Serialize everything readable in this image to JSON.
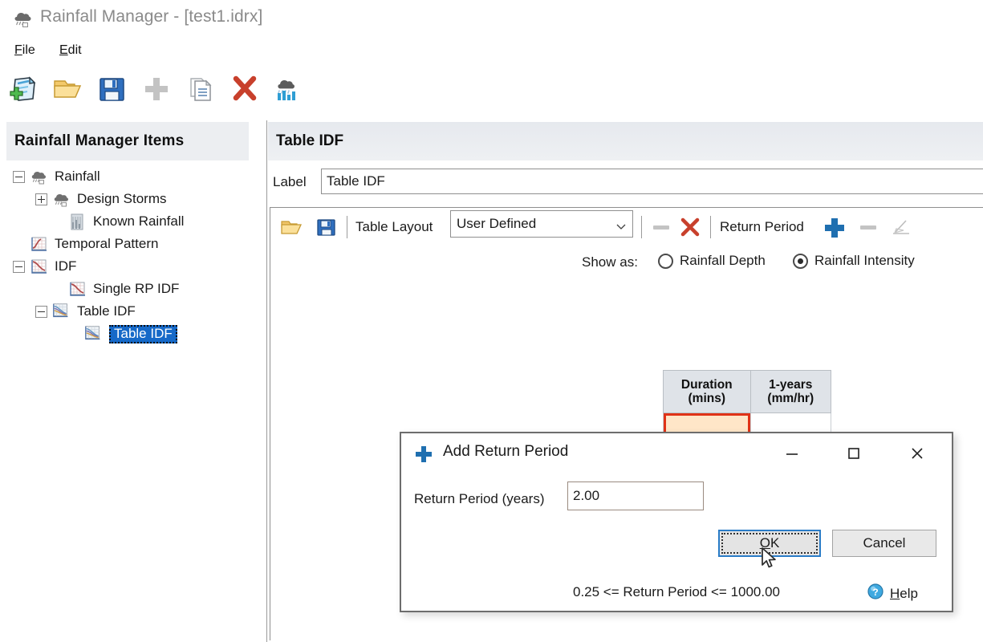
{
  "window": {
    "title": "Rainfall Manager - [test1.idrx]",
    "icon": "rain-cloud-icon"
  },
  "menubar": {
    "items": [
      {
        "label": "File",
        "mnemonic": "F",
        "rest": "ile"
      },
      {
        "label": "Edit",
        "mnemonic": "E",
        "rest": "dit"
      }
    ]
  },
  "toolbar": {
    "buttons": [
      {
        "name": "new-icon",
        "title": "New",
        "enabled": true
      },
      {
        "name": "open-folder-icon",
        "title": "Open",
        "enabled": true
      },
      {
        "name": "save-icon",
        "title": "Save",
        "enabled": true
      },
      {
        "name": "add-plus-icon",
        "title": "Add",
        "enabled": false
      },
      {
        "name": "copy-icon",
        "title": "Copy",
        "enabled": true
      },
      {
        "name": "delete-x-icon",
        "title": "Delete",
        "enabled": true
      },
      {
        "name": "rainfall-chart-icon",
        "title": "Rainfall",
        "enabled": true
      }
    ]
  },
  "sidebar": {
    "header": "Rainfall Manager Items",
    "tree": [
      {
        "label": "Rainfall",
        "indent": 0,
        "twisty": "minus",
        "icon": "rain-cloud-icon",
        "selected": false
      },
      {
        "label": "Design Storms",
        "indent": 1,
        "twisty": "plus",
        "icon": "rain-cloud-icon",
        "selected": false
      },
      {
        "label": "Known Rainfall",
        "indent": 1,
        "twisty": "none",
        "icon": "rain-bars-icon",
        "selected": false
      },
      {
        "label": "Temporal Pattern",
        "indent": 0,
        "twisty": "none",
        "icon": "curve-chart-icon",
        "selected": false
      },
      {
        "label": "IDF",
        "indent": 0,
        "twisty": "minus",
        "icon": "idf-curve-icon",
        "selected": false
      },
      {
        "label": "Single RP IDF",
        "indent": 1,
        "twisty": "none",
        "icon": "idf-curve-icon",
        "selected": false
      },
      {
        "label": "Table IDF",
        "indent": 1,
        "twisty": "minus",
        "icon": "idf-multi-curve-icon",
        "selected": false
      },
      {
        "label": "Table IDF",
        "indent": 2,
        "twisty": "none",
        "icon": "idf-multi-curve-icon",
        "selected": true
      }
    ]
  },
  "main": {
    "panel_title": "Table IDF",
    "label_caption": "Label",
    "label_value": "Table IDF",
    "idf_toolbar": {
      "open_icon": "open-folder-icon",
      "save_icon": "save-icon",
      "table_layout_caption": "Table Layout",
      "table_layout_value": "User Defined",
      "table_layout_options": [
        "User Defined"
      ],
      "remove_row_icon": "minus-icon",
      "delete_table_icon": "delete-x-icon",
      "return_period_caption": "Return Period",
      "add_rp_icon": "plus-icon",
      "remove_rp_icon": "minus-icon",
      "edit_rp_icon": "edit-pencil-icon"
    },
    "show_as": {
      "caption": "Show as:",
      "options": [
        {
          "label": "Rainfall Depth",
          "selected": false
        },
        {
          "label": "Rainfall Intensity",
          "selected": true
        }
      ]
    },
    "table": {
      "headers": [
        "Duration\n(mins)",
        "1-years\n(mm/hr)"
      ],
      "rows": [
        [
          "",
          ""
        ]
      ],
      "active_cell": [
        0,
        0
      ]
    }
  },
  "dialog": {
    "title": "Add Return Period",
    "title_icon": "plus-icon",
    "minimize_icon": "minimize-icon",
    "maximize_icon": "maximize-icon",
    "close_icon": "close-icon",
    "field_caption": "Return Period (years)",
    "field_value": "2.00",
    "ok": {
      "mnemonic": "O",
      "rest": "K"
    },
    "cancel_label": "Cancel",
    "hint": "0.25 <= Return Period <= 1000.00",
    "help": {
      "icon": "help-question-icon",
      "mnemonic": "H",
      "rest": "elp"
    }
  },
  "colors": {
    "accent_blue": "#1669c8",
    "focus_blue": "#2a7cc7",
    "active_cell_fill": "#ffe6c8",
    "active_cell_border": "#e03217",
    "header_gray": "#dfe3e8",
    "title_gray": "#8a8a8a"
  }
}
